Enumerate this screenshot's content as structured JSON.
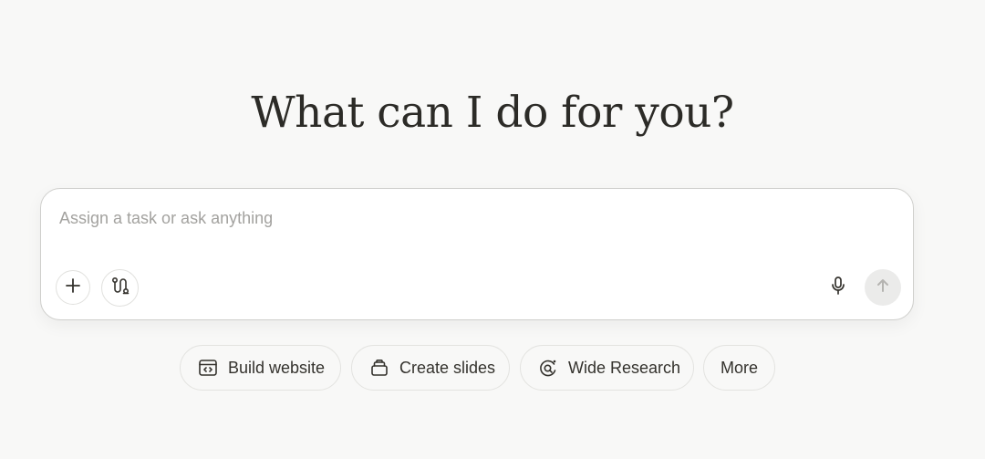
{
  "headline": "What can I do for you?",
  "composer": {
    "placeholder": "Assign a task or ask anything",
    "value": "",
    "add_icon": "plus-icon",
    "connector_icon": "connectors-icon",
    "mic_icon": "microphone-icon",
    "send_icon": "arrow-up-icon"
  },
  "quick_actions": [
    {
      "label": "Build website",
      "icon": "browser-code-icon"
    },
    {
      "label": "Create slides",
      "icon": "slides-stack-icon"
    },
    {
      "label": "Wide Research",
      "icon": "research-orbit-icon"
    },
    {
      "label": "More",
      "icon": ""
    }
  ],
  "colors": {
    "background": "#f8f8f7",
    "text": "#34322d",
    "placeholder": "#a3a29f",
    "send_button_bg": "#ebebea",
    "border": "#cfcfcc"
  }
}
